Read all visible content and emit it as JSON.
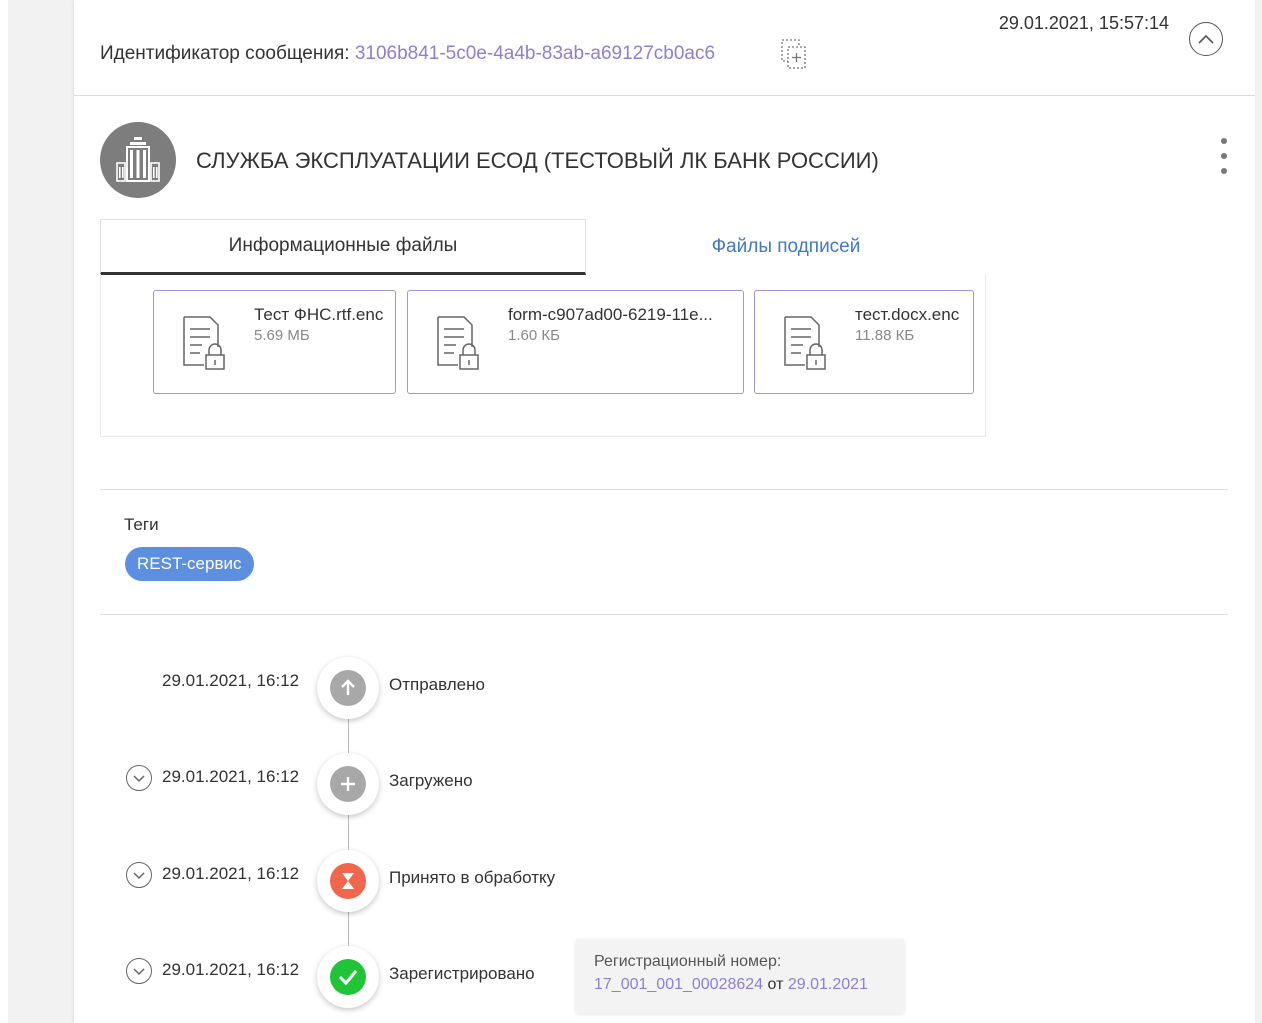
{
  "header": {
    "message_id_label": "Идентификатор сообщения: ",
    "message_id_value": "3106b841-5c0e-4a4b-83ab-a69127cb0ac6",
    "timestamp": "29.01.2021, 15:57:14",
    "icons": {
      "copy": "copy-icon",
      "collapse": "chevron-up-icon"
    }
  },
  "sender": {
    "name": "СЛУЖБА ЭКСПЛУАТАЦИИ ЕСОД (ТЕСТОВЫЙ ЛК БАНК РОССИИ)",
    "avatar_icon": "bank-building-icon",
    "menu_icon": "more-vertical-icon"
  },
  "tabs": [
    {
      "label": "Информационные файлы",
      "active": true
    },
    {
      "label": "Файлы подписей",
      "active": false
    }
  ],
  "files": [
    {
      "name": "Тест ФНС.rtf.enc",
      "size": "5.69 МБ",
      "icon": "encrypted-file-icon"
    },
    {
      "name": "form-c907ad00-6219-11e...",
      "size": "1.60 КБ",
      "icon": "encrypted-file-icon"
    },
    {
      "name": "тест.docx.enc",
      "size": "11.88 КБ",
      "icon": "encrypted-file-icon"
    }
  ],
  "tags": {
    "title": "Теги",
    "items": [
      "REST-сервис"
    ]
  },
  "timeline": [
    {
      "date": "29.01.2021, 16:12",
      "status": "Отправлено",
      "icon": "arrow-up-icon",
      "color": "#a8a8a8",
      "expandable": false
    },
    {
      "date": "29.01.2021, 16:12",
      "status": "Загружено",
      "icon": "plus-icon",
      "color": "#a8a8a8",
      "expandable": true
    },
    {
      "date": "29.01.2021, 16:12",
      "status": "Принято в обработку",
      "icon": "hourglass-icon",
      "color": "#f0674e",
      "expandable": true
    },
    {
      "date": "29.01.2021, 16:12",
      "status": "Зарегистрировано",
      "icon": "check-icon",
      "color": "#1fc537",
      "expandable": true
    }
  ],
  "registration": {
    "label": "Регистрационный номер:",
    "number": "17_001_001_00028624",
    "from_word": " от ",
    "date": "29.01.2021"
  },
  "colors": {
    "accent_link": "#8c7fd6",
    "tab_link": "#3f79c9",
    "tag_bg": "#5c8fe0",
    "file_border": "#9e97d9"
  }
}
